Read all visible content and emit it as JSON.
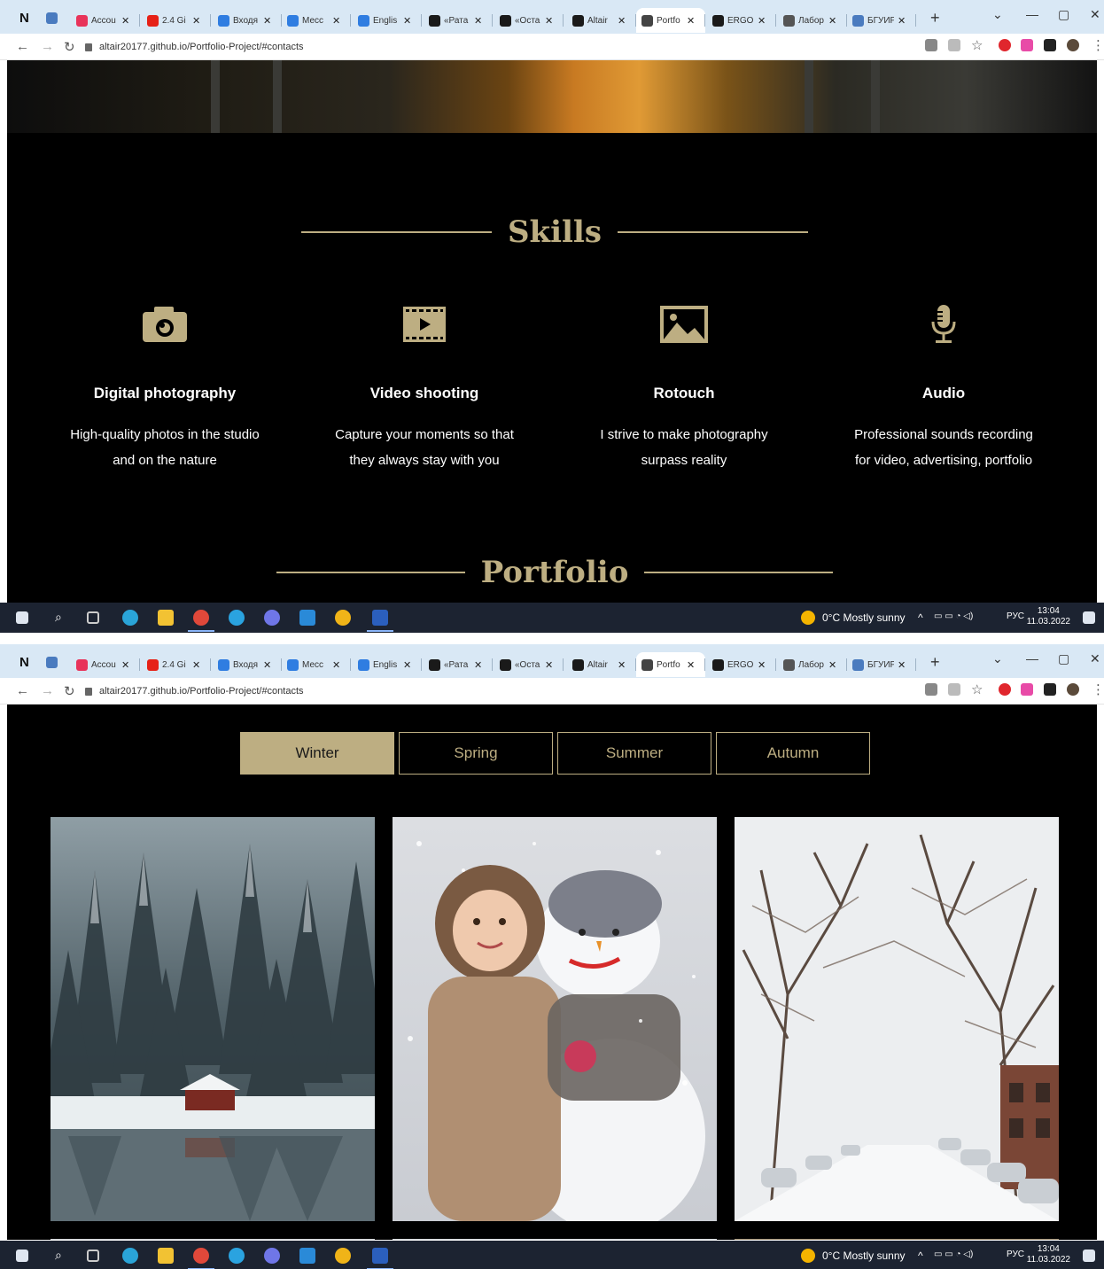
{
  "browser": {
    "tabs": [
      {
        "label": "Accou",
        "color": "#e8335a"
      },
      {
        "label": "2.4 Gi",
        "color": "#e62117"
      },
      {
        "label": "Входя",
        "color": "#2f7de1"
      },
      {
        "label": "Месс",
        "color": "#2f7de1"
      },
      {
        "label": "Englis",
        "color": "#2f7de1"
      },
      {
        "label": "«Рата",
        "color": "#1a1a1a"
      },
      {
        "label": "«Оста",
        "color": "#1a1a1a"
      },
      {
        "label": "Altair",
        "color": "#1a1a1a"
      },
      {
        "label": "Portfo",
        "color": "#444444"
      },
      {
        "label": "ERGO",
        "color": "#1a1a1a"
      },
      {
        "label": "Лабор",
        "color": "#555555"
      },
      {
        "label": "БГУИР",
        "color": "#4a7bbf"
      }
    ],
    "active_tab": "Portfo",
    "new_tab": "+",
    "url": "altair20177.github.io/Portfolio-Project/#contacts"
  },
  "skills": {
    "title": "Skills",
    "items": [
      {
        "name": "Digital photography",
        "line1": "High-quality photos in the studio",
        "line2": "and on the nature",
        "icon": "camera-icon"
      },
      {
        "name": "Video shooting",
        "line1": "Capture your moments so that",
        "line2": "they always stay with you",
        "icon": "video-icon"
      },
      {
        "name": "Rotouch",
        "line1": "I strive to make photography",
        "line2": "surpass reality",
        "icon": "picture-icon"
      },
      {
        "name": "Audio",
        "line1": "Professional sounds recording",
        "line2": "for video, advertising, portfolio",
        "icon": "microphone-icon"
      }
    ]
  },
  "portfolio": {
    "title": "Portfolio",
    "filters": [
      "Winter",
      "Spring",
      "Summer",
      "Autumn"
    ],
    "active_filter": "Winter"
  },
  "taskbar": {
    "weather": "0°C  Mostly sunny",
    "lang": "РУС",
    "time": "13:04",
    "date": "11.03.2022"
  },
  "colors": {
    "accent": "#bdae82",
    "background": "#000000"
  }
}
